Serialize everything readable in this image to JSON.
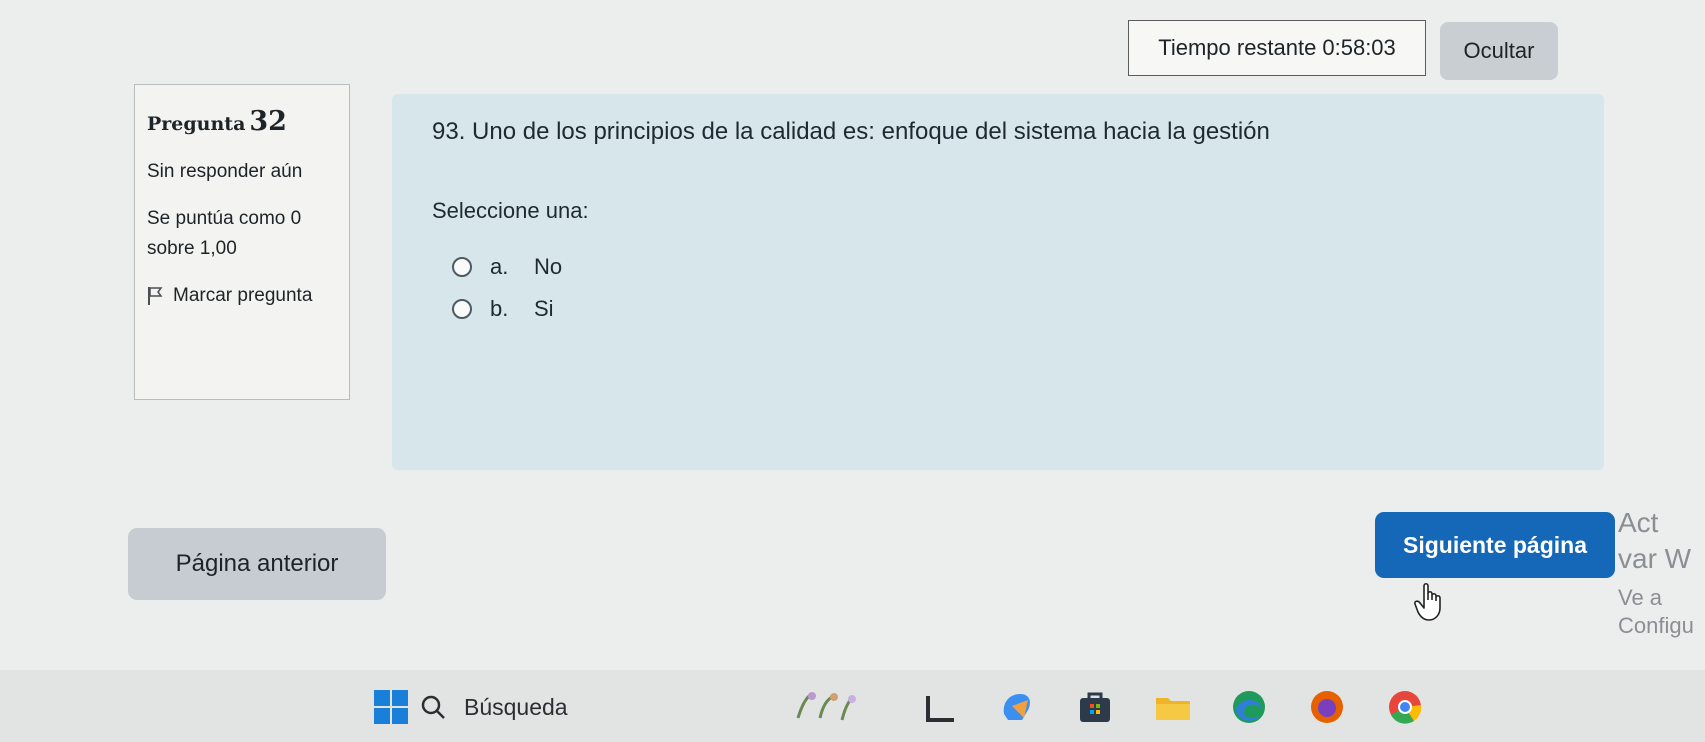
{
  "timer": {
    "label": "Tiempo restante",
    "value": "0:58:03"
  },
  "hide_button": "Ocultar",
  "question_info": {
    "title": "Pregunta",
    "number": "32",
    "state": "Sin responder aún",
    "grade": "Se puntúa como 0 sobre 1,00",
    "flag_label": "Marcar pregunta"
  },
  "question": {
    "text": "93. Uno de los principios de la calidad es: enfoque del sistema hacia la gestión",
    "prompt": "Seleccione una:",
    "options": [
      {
        "letter": "a.",
        "label": "No",
        "selected": false
      },
      {
        "letter": "b.",
        "label": "Si",
        "selected": false
      }
    ]
  },
  "nav": {
    "prev": "Página anterior",
    "next": "Siguiente página"
  },
  "watermark": {
    "line1": "Act var W",
    "line2": "Ve a Configu"
  },
  "taskbar": {
    "search_placeholder": "Búsqueda",
    "icons": [
      "windows-start-icon",
      "search-icon",
      "widgets-icon",
      "task-view-icon",
      "copilot-icon",
      "store-icon",
      "file-explorer-icon",
      "edge-icon",
      "firefox-icon",
      "chrome-icon"
    ]
  },
  "colors": {
    "panel_bg": "#d7e6eb",
    "primary": "#1567b8",
    "secondary_btn": "#c7ccd3"
  }
}
